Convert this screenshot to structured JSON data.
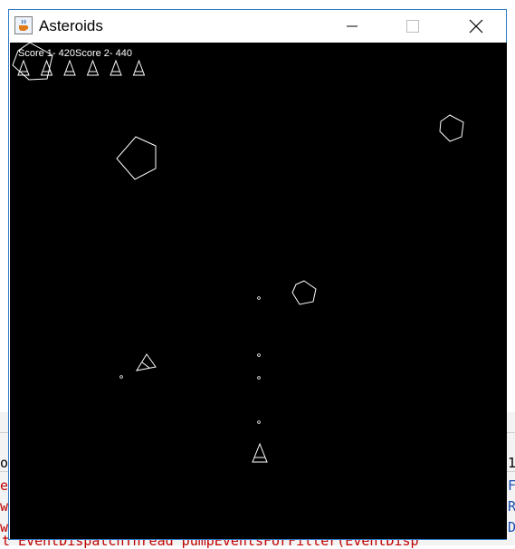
{
  "window": {
    "title": "Asteroids",
    "icon": "java-cup-icon"
  },
  "title_bar_controls": {
    "minimize": "minimize-icon",
    "maximize": "maximize-icon",
    "close": "close-icon"
  },
  "hud": {
    "score1": "Score 1- 420",
    "score2": "Score 2- 440",
    "lives_remaining": 6
  },
  "colors": {
    "canvas_bg": "#000000",
    "foreground": "#ffffff",
    "window_border": "#2b79c7"
  },
  "background_fragments": {
    "left_1": "e",
    "left_2": "w",
    "left_3": "w",
    "left_top": "ol",
    "right_1": "F",
    "right_2": "R",
    "right_3": "D",
    "right_top": "1",
    "bottom": "t EventDispatchThread pumpEventsForFilter(EventDisp"
  }
}
